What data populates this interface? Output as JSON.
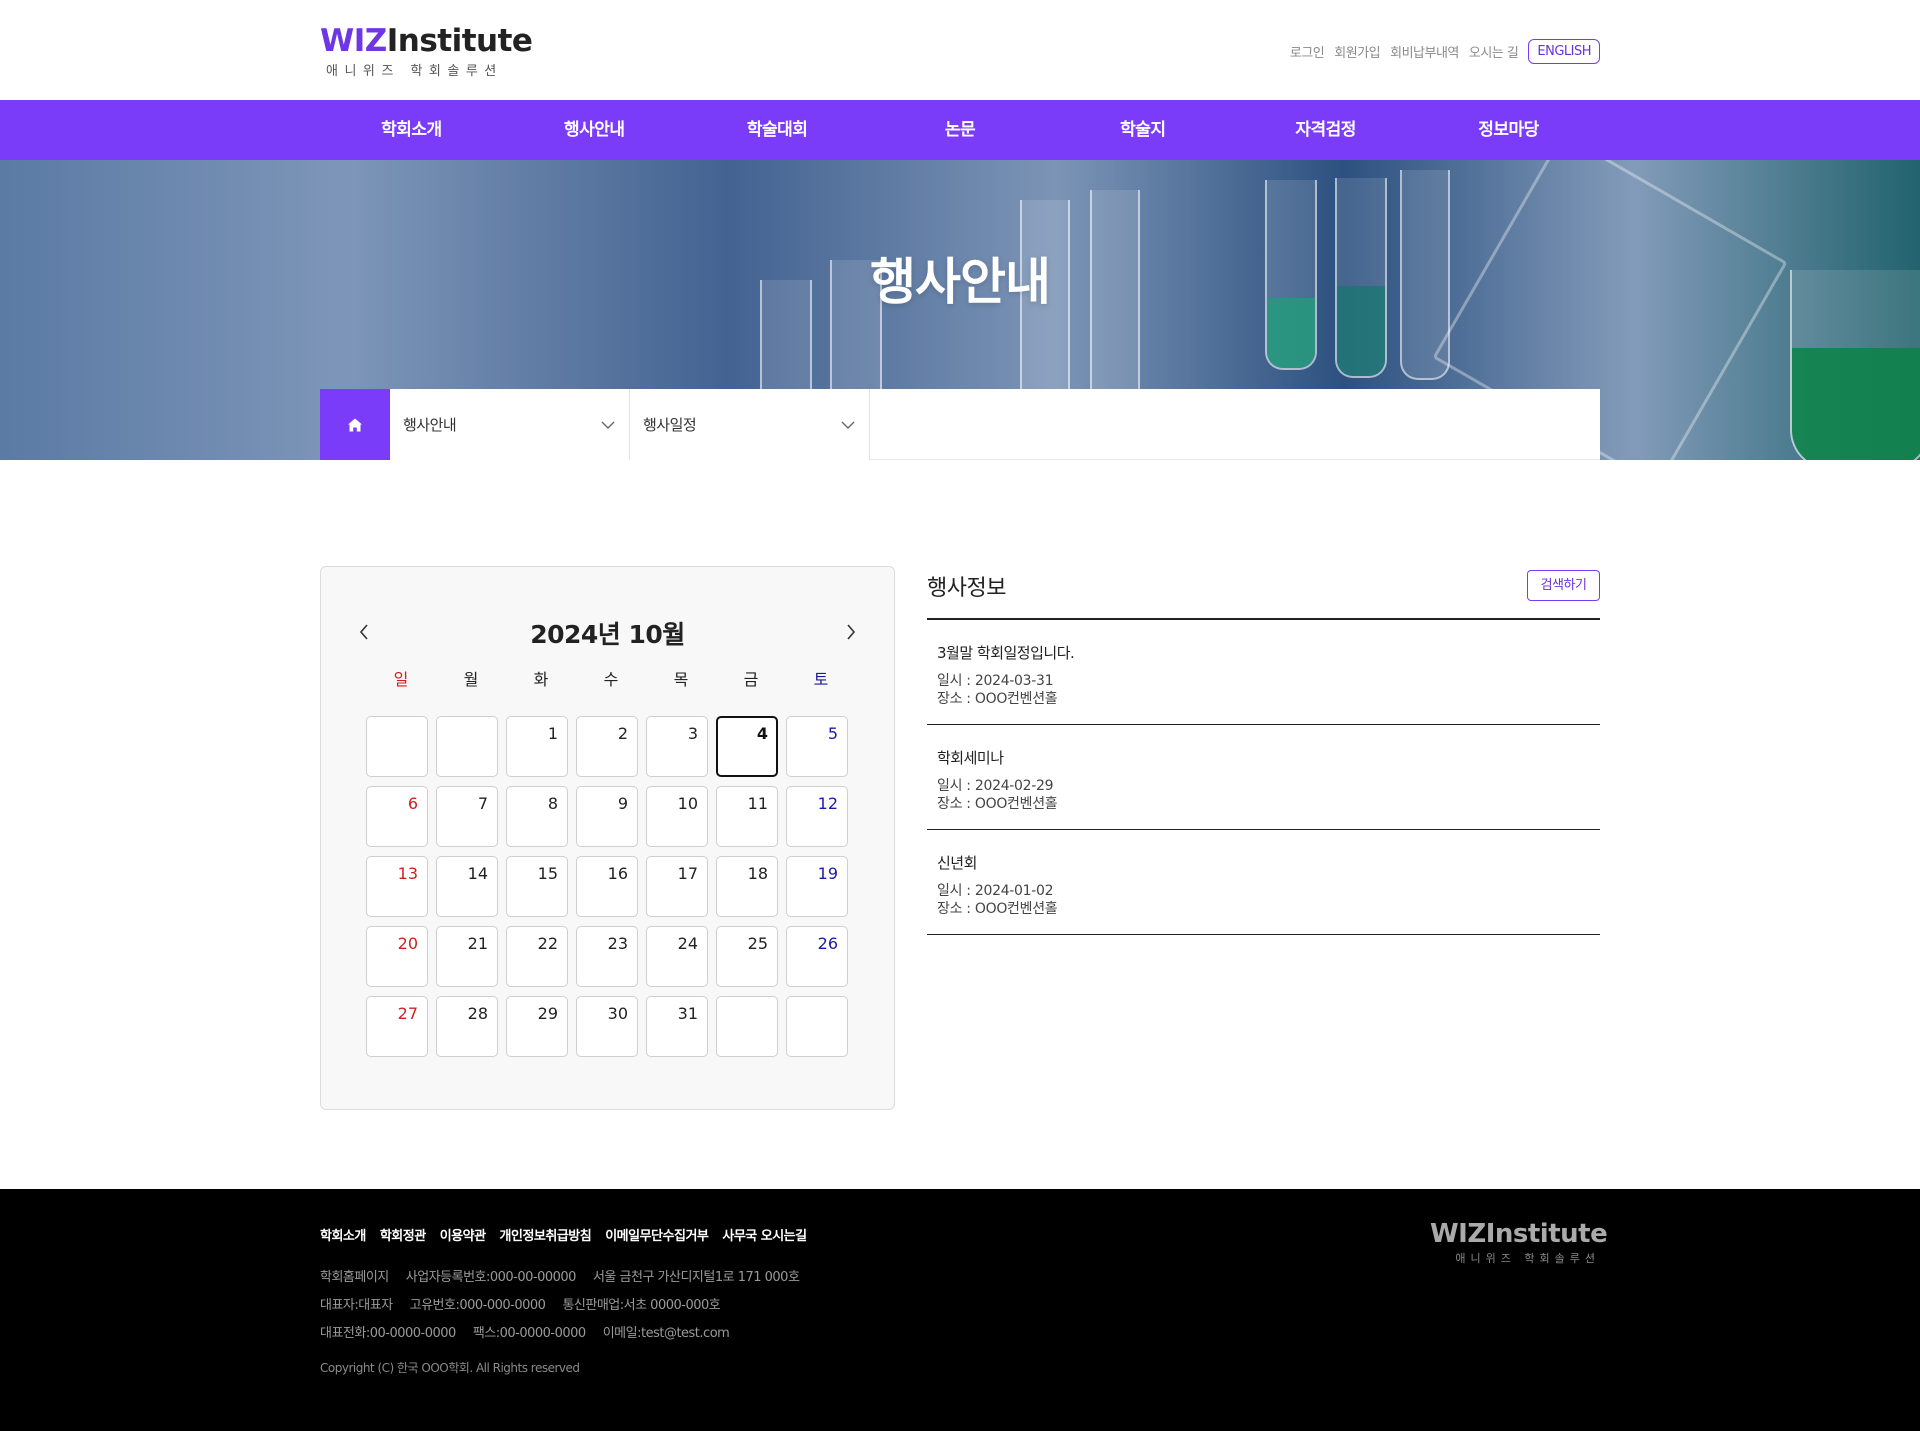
{
  "header": {
    "logo_brand_a": "WIZ",
    "logo_brand_b": "Institute",
    "logo_sub": "애니위즈 학회솔루션",
    "util_links": [
      "로그인",
      "회원가입",
      "회비납부내역",
      "오시는 길"
    ],
    "lang_button": "ENGLISH"
  },
  "gnb": [
    "학회소개",
    "행사안내",
    "학술대회",
    "논문",
    "학술지",
    "자격검정",
    "정보마당"
  ],
  "banner": {
    "title": "행사안내"
  },
  "location": {
    "depth1": "행사안내",
    "depth2": "행사일정"
  },
  "calendar": {
    "title": "2024년 10월",
    "weekdays": [
      "일",
      "월",
      "화",
      "수",
      "목",
      "금",
      "토"
    ],
    "days": [
      "",
      "",
      "1",
      "2",
      "3",
      "4",
      "5",
      "6",
      "7",
      "8",
      "9",
      "10",
      "11",
      "12",
      "13",
      "14",
      "15",
      "16",
      "17",
      "18",
      "19",
      "20",
      "21",
      "22",
      "23",
      "24",
      "25",
      "26",
      "27",
      "28",
      "29",
      "30",
      "31",
      "",
      ""
    ],
    "today": "4"
  },
  "events": {
    "title": "행사정보",
    "search_button": "검색하기",
    "items": [
      {
        "title": "3월말 학회일정입니다.",
        "date": "일시 : 2024-03-31",
        "place": "장소 : OOO컨벤션홀"
      },
      {
        "title": "학회세미나",
        "date": "일시 : 2024-02-29",
        "place": "장소 : OOO컨벤션홀"
      },
      {
        "title": "신년회",
        "date": "일시 : 2024-01-02",
        "place": "장소 : OOO컨벤션홀"
      }
    ]
  },
  "footer": {
    "links": [
      "학회소개",
      "학회정관",
      "이용약관",
      "개인정보취급방침",
      "이메일무단수집거부",
      "사무국 오시는길"
    ],
    "row1": [
      "학회홈페이지",
      "사업자등록번호:000-00-00000",
      "서울 금천구 가산디지털1로 171 000호"
    ],
    "row2": [
      "대표자:대표자",
      "고유번호:000-000-0000",
      "통신판매업:서초 0000-000호"
    ],
    "row3": [
      "대표전화:00-0000-0000",
      "팩스:00-0000-0000",
      "이메일:test@test.com"
    ],
    "copyright": "Copyright (C) 한국 OOO학회. All Rights reserved"
  },
  "colors": {
    "brand": "#7a3cf8",
    "sunday": "#cc2222",
    "saturday": "#1a1aa8"
  },
  "icons": {
    "home": "home-icon",
    "prev": "chevron-left-icon",
    "next": "chevron-right-icon",
    "dropdown": "chevron-down-icon"
  }
}
